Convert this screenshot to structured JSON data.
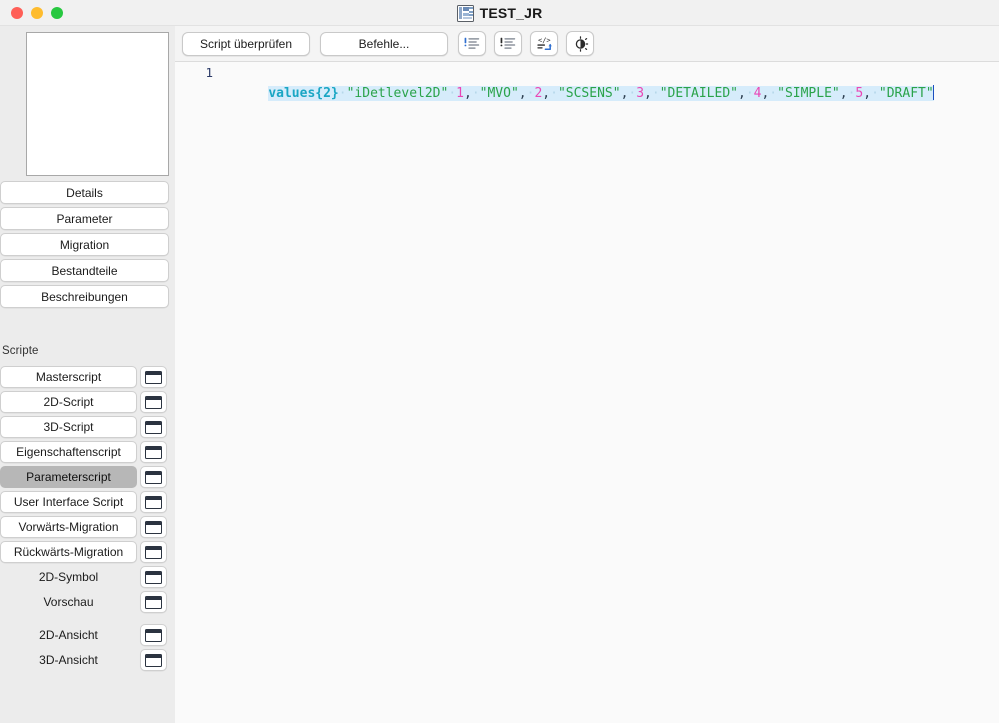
{
  "window": {
    "title": "TEST_JR",
    "title_icon": "library-document-icon",
    "controls": [
      {
        "name": "close",
        "color": "#ff5f57"
      },
      {
        "name": "minimize",
        "color": "#febc2e"
      },
      {
        "name": "maximize",
        "color": "#28c840"
      }
    ]
  },
  "toolbar": {
    "check_script_label": "Script überprüfen",
    "commands_label": "Befehle...",
    "icons": [
      {
        "name": "error-list-blue-icon",
        "accent": "#2f6fd0"
      },
      {
        "name": "error-list-dark-icon",
        "accent": "#2b2b2b"
      },
      {
        "name": "code-format-icon",
        "accent": "#2f6fd0"
      },
      {
        "name": "brightness-contrast-icon",
        "accent": "#2b2b2b"
      }
    ]
  },
  "rail": {
    "items": [
      {
        "name": "rail-item-floorplan",
        "selected": false
      },
      {
        "name": "rail-item-square",
        "selected": false
      },
      {
        "name": "rail-item-section",
        "selected": false
      },
      {
        "name": "rail-item-3d-box",
        "selected": false
      },
      {
        "name": "rail-item-filmstrip",
        "selected": true
      }
    ]
  },
  "sidebar": {
    "preview_name": "preview-thumbnail",
    "tabs": [
      "Details",
      "Parameter",
      "Migration",
      "Bestandteile",
      "Beschreibungen"
    ],
    "section_label": "Scripte",
    "scripts": [
      {
        "label": "Masterscript",
        "selected": false,
        "boxed": true,
        "gap_before": false
      },
      {
        "label": "2D-Script",
        "selected": false,
        "boxed": true,
        "gap_before": false
      },
      {
        "label": "3D-Script",
        "selected": false,
        "boxed": true,
        "gap_before": false
      },
      {
        "label": "Eigenschaftenscript",
        "selected": false,
        "boxed": true,
        "gap_before": false
      },
      {
        "label": "Parameterscript",
        "selected": true,
        "boxed": true,
        "gap_before": false
      },
      {
        "label": "User Interface Script",
        "selected": false,
        "boxed": true,
        "gap_before": false
      },
      {
        "label": "Vorwärts-Migration",
        "selected": false,
        "boxed": true,
        "gap_before": false
      },
      {
        "label": "Rückwärts-Migration",
        "selected": false,
        "boxed": true,
        "gap_before": false
      },
      {
        "label": "2D-Symbol",
        "selected": false,
        "boxed": false,
        "gap_before": false
      },
      {
        "label": "Vorschau",
        "selected": false,
        "boxed": false,
        "gap_before": false
      },
      {
        "label": "2D-Ansicht",
        "selected": false,
        "boxed": false,
        "gap_before": true
      },
      {
        "label": "3D-Ansicht",
        "selected": false,
        "boxed": false,
        "gap_before": false
      }
    ]
  },
  "editor": {
    "line_number": "1",
    "tokens": [
      {
        "text": "values{2}",
        "type": "kw"
      },
      {
        "text": "·",
        "type": "dot"
      },
      {
        "text": "\"iDetlevel2D\"",
        "type": "str"
      },
      {
        "text": "·",
        "type": "dot"
      },
      {
        "text": "1",
        "type": "num"
      },
      {
        "text": ",",
        "type": "pun"
      },
      {
        "text": "·",
        "type": "dot"
      },
      {
        "text": "\"MVO\"",
        "type": "str"
      },
      {
        "text": ",",
        "type": "pun"
      },
      {
        "text": "·",
        "type": "dot"
      },
      {
        "text": "2",
        "type": "num"
      },
      {
        "text": ",",
        "type": "pun"
      },
      {
        "text": "·",
        "type": "dot"
      },
      {
        "text": "\"SCSENS\"",
        "type": "str"
      },
      {
        "text": ",",
        "type": "pun"
      },
      {
        "text": "·",
        "type": "dot"
      },
      {
        "text": "3",
        "type": "num"
      },
      {
        "text": ",",
        "type": "pun"
      },
      {
        "text": "·",
        "type": "dot"
      },
      {
        "text": "\"DETAILED\"",
        "type": "str"
      },
      {
        "text": ",",
        "type": "pun"
      },
      {
        "text": "·",
        "type": "dot"
      },
      {
        "text": "4",
        "type": "num"
      },
      {
        "text": ",",
        "type": "pun"
      },
      {
        "text": "·",
        "type": "dot"
      },
      {
        "text": "\"SIMPLE\"",
        "type": "str"
      },
      {
        "text": ",",
        "type": "pun"
      },
      {
        "text": "·",
        "type": "dot"
      },
      {
        "text": "5",
        "type": "num"
      },
      {
        "text": ",",
        "type": "pun"
      },
      {
        "text": "·",
        "type": "dot"
      },
      {
        "text": "\"DRAFT\"",
        "type": "str"
      }
    ],
    "plain_text": "values{2} \"iDetlevel2D\" 1, \"MVO\", 2, \"SCSENS\", 3, \"DETAILED\", 4, \"SIMPLE\", 5, \"DRAFT\"",
    "colors": {
      "keyword": "#1aa6c4",
      "string": "#2aa34a",
      "number": "#ea46b6",
      "punctuation": "#2c3e50",
      "selection": "#d6ecfb",
      "line_number": "#2b3a67"
    }
  }
}
